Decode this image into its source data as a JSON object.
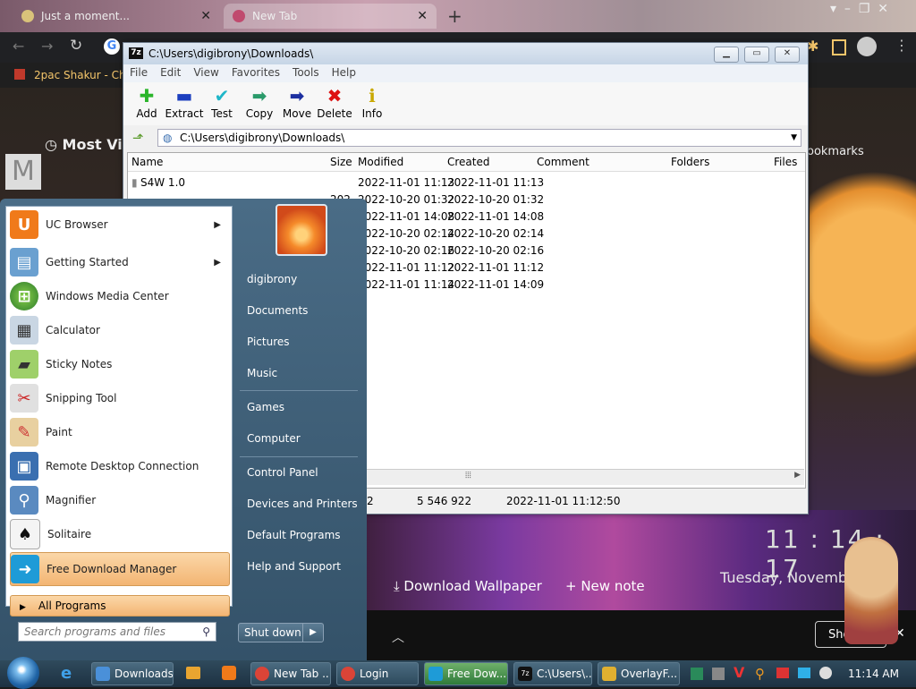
{
  "chrome": {
    "tabs": [
      {
        "label": "Just a moment..."
      },
      {
        "label": "New Tab"
      }
    ],
    "new_tab": "+",
    "bookmark": "2pac Shakur - Chro",
    "most_visited": "Most Visi",
    "bookmarks_label": "ookmarks"
  },
  "zip": {
    "title": "C:\\Users\\digibrony\\Downloads\\",
    "menu": [
      "File",
      "Edit",
      "View",
      "Favorites",
      "Tools",
      "Help"
    ],
    "toolbar": [
      {
        "label": "Add",
        "icon": "plus-icon"
      },
      {
        "label": "Extract",
        "icon": "minus-icon"
      },
      {
        "label": "Test",
        "icon": "check-icon"
      },
      {
        "label": "Copy",
        "icon": "copy-arrow-icon"
      },
      {
        "label": "Move",
        "icon": "move-arrow-icon"
      },
      {
        "label": "Delete",
        "icon": "x-icon"
      },
      {
        "label": "Info",
        "icon": "info-icon"
      }
    ],
    "address": "C:\\Users\\digibrony\\Downloads\\",
    "columns": {
      "name": "Name",
      "size": "Size",
      "modified": "Modified",
      "created": "Created",
      "comment": "Comment",
      "folders": "Folders",
      "files": "Files"
    },
    "rows": [
      {
        "name": "S4W 1.0",
        "size": "",
        "modified": "2022-11-01 11:13",
        "created": "2022-11-01 11:13"
      },
      {
        "name": "",
        "size": "202",
        "modified": "2022-10-20 01:32",
        "created": "2022-10-20 01:32"
      },
      {
        "name": "",
        "size": "",
        "modified": "2022-11-01 14:08",
        "created": "2022-11-01 14:08"
      },
      {
        "name": "",
        "size": "",
        "modified": "2022-10-20 02:14",
        "created": "2022-10-20 02:14"
      },
      {
        "name": "",
        "size": "",
        "modified": "2022-10-20 02:16",
        "created": "2022-10-20 02:16"
      },
      {
        "name": "",
        "size": "",
        "modified": "2022-11-01 11:12",
        "created": "2022-11-01 11:12"
      },
      {
        "name": "",
        "size": "",
        "modified": "2022-11-01 11:14",
        "created": "2022-11-01 14:09"
      }
    ],
    "status": {
      "count": "2",
      "size": "5 546 922",
      "date": "2022-11-01 11:12:50"
    }
  },
  "wallpaper": {
    "clock": "11 : 14 : 17",
    "date": "Tuesday, November",
    "download": "Download Wallpaper",
    "new_note": "+ New note",
    "show": "Show"
  },
  "start_menu": {
    "programs": [
      {
        "label": "UC Browser",
        "submenu": true
      },
      {
        "label": "Getting Started",
        "submenu": true
      },
      {
        "label": "Windows Media Center",
        "submenu": false
      },
      {
        "label": "Calculator",
        "submenu": false
      },
      {
        "label": "Sticky Notes",
        "submenu": false
      },
      {
        "label": "Snipping Tool",
        "submenu": false
      },
      {
        "label": "Paint",
        "submenu": false
      },
      {
        "label": "Remote Desktop Connection",
        "submenu": false
      },
      {
        "label": "Magnifier",
        "submenu": false
      },
      {
        "label": "Solitaire",
        "submenu": false
      },
      {
        "label": "Free Download Manager",
        "submenu": false
      }
    ],
    "all_programs": "All Programs",
    "search_placeholder": "Search programs and files",
    "right": [
      "digibrony",
      "Documents",
      "Pictures",
      "Music",
      "Games",
      "Computer",
      "Control Panel",
      "Devices and Printers",
      "Default Programs",
      "Help and Support"
    ],
    "shutdown": "Shut down"
  },
  "taskbar": {
    "items": [
      "Downloads",
      "New Tab ...",
      "Login",
      "Free Dow...",
      "C:\\Users\\...",
      "OverlayF..."
    ],
    "time": "11:14 AM"
  }
}
